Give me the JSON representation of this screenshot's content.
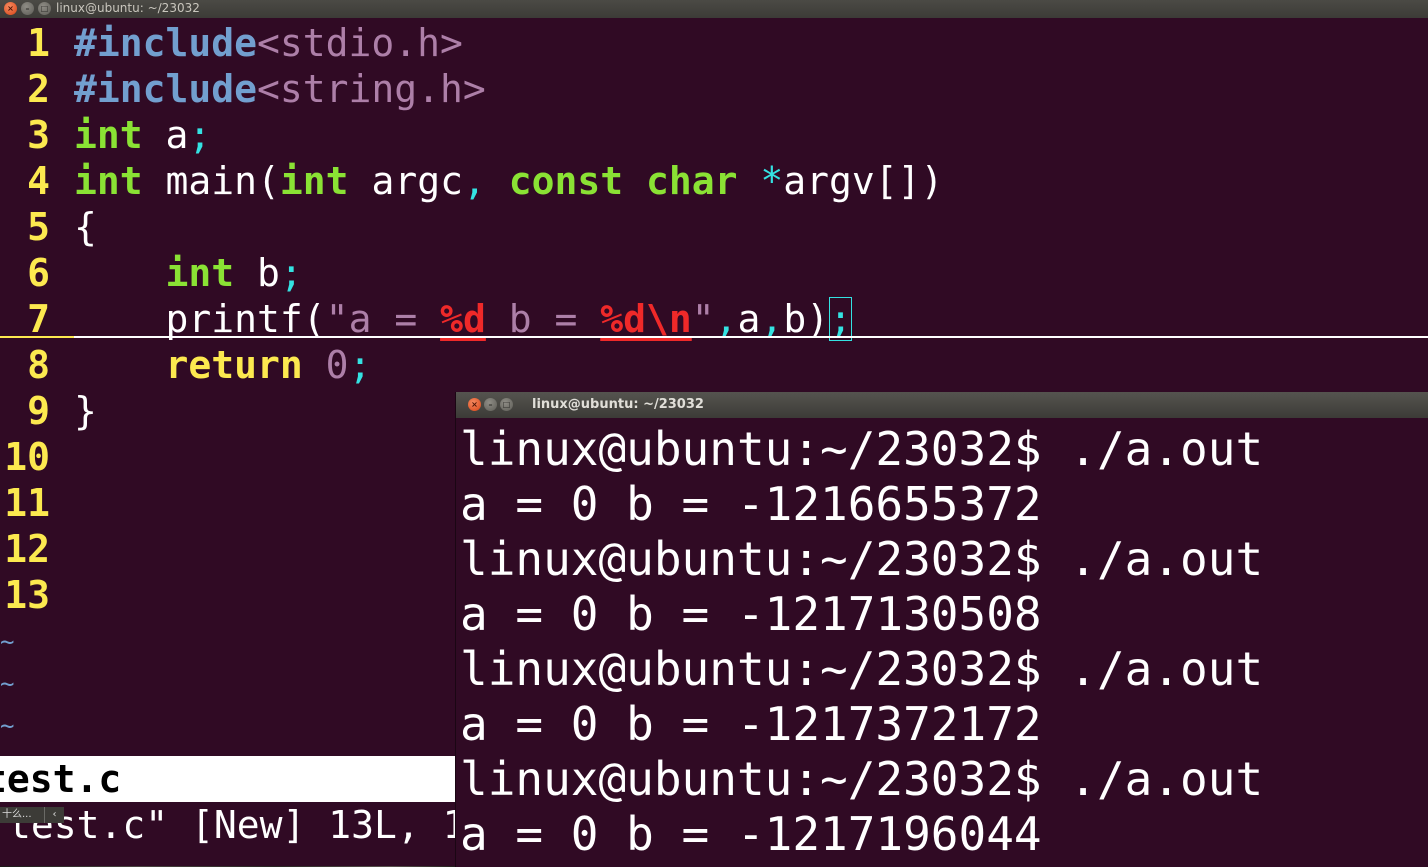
{
  "top_window": {
    "title": "linux@ubuntu: ~/23032"
  },
  "editor": {
    "lines": [
      {
        "n": "1"
      },
      {
        "n": "2"
      },
      {
        "n": "3"
      },
      {
        "n": "4"
      },
      {
        "n": "5"
      },
      {
        "n": "6"
      },
      {
        "n": "7"
      },
      {
        "n": "8"
      },
      {
        "n": "9"
      },
      {
        "n": "10"
      },
      {
        "n": "11"
      },
      {
        "n": "12"
      },
      {
        "n": "13"
      }
    ],
    "code": {
      "l1_pp": "#include",
      "l1_inc": "<stdio.h>",
      "l2_pp": "#include",
      "l2_inc": "<string.h>",
      "l3_kw": "int",
      "l3_rest": " a",
      "l3_semi": ";",
      "l4_kw": "int",
      "l4_main": " main(",
      "l4_kw2": "int",
      "l4_argc": " argc",
      "l4_comma": ",",
      "l4_const": " const",
      "l4_char": " char",
      "l4_star": " *",
      "l4_argv": "argv[])",
      "l5": "{",
      "l6_kw": "int",
      "l6_b": " b",
      "l6_semi": ";",
      "l7_fn": "printf(",
      "l7_q1": "\"",
      "l7_s1": "a = ",
      "l7_f1": "%d",
      "l7_s2": " b = ",
      "l7_f2": "%d\\n",
      "l7_q2": "\"",
      "l7_c1": ",",
      "l7_a": "a",
      "l7_c2": ",",
      "l7_b": "b)",
      "l7_semi": ";",
      "l8_ret": "return",
      "l8_num": " 0",
      "l8_semi": ";",
      "l9": "}"
    },
    "tildes": [
      "~",
      "~",
      "~"
    ],
    "statusline": "test.c",
    "message": "test.c\" [New] 13L, 1",
    "ime": {
      "label": "十么...",
      "arrow": "‹"
    }
  },
  "terminal": {
    "title": "linux@ubuntu: ~/23032",
    "lines": [
      "linux@ubuntu:~/23032$ ./a.out",
      "a = 0 b = -1216655372",
      "linux@ubuntu:~/23032$ ./a.out",
      "a = 0 b = -1217130508",
      "linux@ubuntu:~/23032$ ./a.out",
      "a = 0 b = -1217372172",
      "linux@ubuntu:~/23032$ ./a.out",
      "a = 0 b = -1217196044"
    ]
  }
}
